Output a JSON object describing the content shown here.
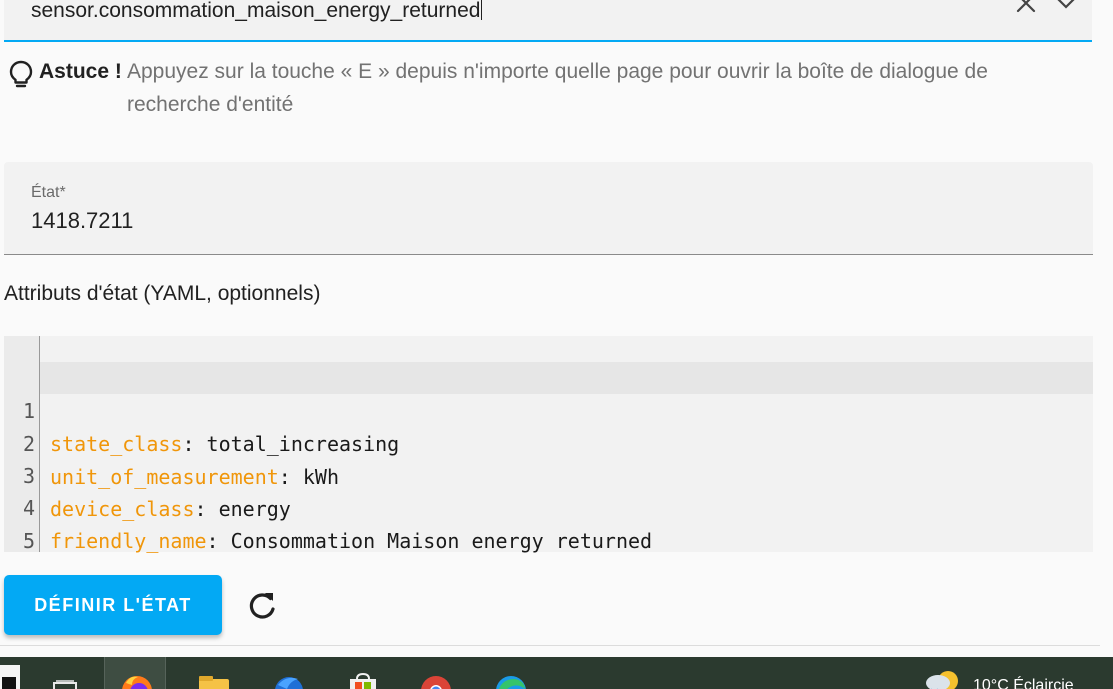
{
  "entity": {
    "value": "sensor.consommation_maison_energy_returned",
    "clear_icon": "close-icon",
    "dropdown_icon": "chevron-down-icon"
  },
  "tip": {
    "icon": "lightbulb-icon",
    "label": "Astuce !",
    "text": "Appuyez sur la touche « E » depuis n'importe quelle page pour ouvrir la boîte de dialogue de recherche d'entité"
  },
  "state": {
    "label": "État*",
    "value": "1418.7211"
  },
  "attributes": {
    "heading": "Attributs d'état (YAML, optionnels)",
    "lines": [
      {
        "num": "1",
        "key": "state_class",
        "sep": ": ",
        "value": "total_increasing"
      },
      {
        "num": "2",
        "key": "unit_of_measurement",
        "sep": ": ",
        "value": "kWh"
      },
      {
        "num": "3",
        "key": "device_class",
        "sep": ": ",
        "value": "energy"
      },
      {
        "num": "4",
        "key": "friendly_name",
        "sep": ": ",
        "value": "Consommation Maison energy returned"
      },
      {
        "num": "5",
        "key": "",
        "sep": "",
        "value": ""
      }
    ]
  },
  "actions": {
    "set_state_label": "DÉFINIR L'ÉTAT",
    "refresh_icon": "refresh-icon"
  },
  "taskbar": {
    "weather_text": "10°C  Éclaircie",
    "weather_icon": "partly-cloudy-rain-icon",
    "apps": [
      "task-view-icon",
      "firefox-icon",
      "file-explorer-icon",
      "thunderbird-icon",
      "microsoft-store-icon",
      "chrome-icon",
      "edge-icon"
    ]
  },
  "colors": {
    "accent": "#03a9f4",
    "yaml_key": "#f0960a",
    "taskbar": "#2b3a2f"
  }
}
